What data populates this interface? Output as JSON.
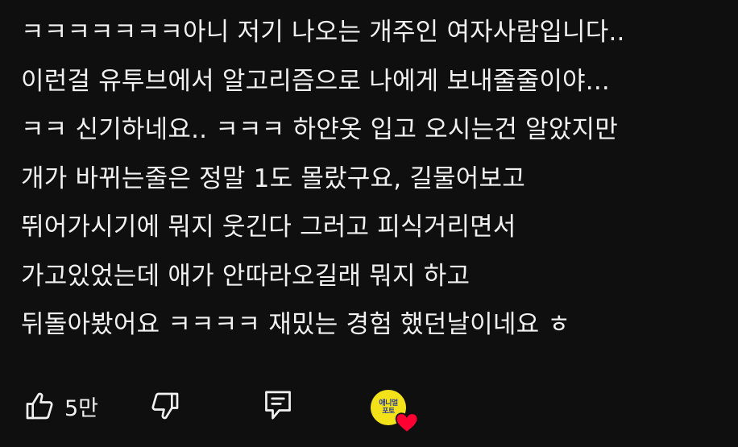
{
  "comment": {
    "lines": [
      "ㅋㅋㅋㅋㅋㅋㅋ아니 저기 나오는 개주인  여자사람입니다..",
      "이런걸 유투브에서 알고리즘으로 나에게 보내줄줄이야...",
      "ㅋㅋ 신기하네요.. ㅋㅋㅋ 하얀옷 입고 오시는건 알았지만",
      "개가 바뀌는줄은 정말 1도 몰랐구요, 길물어보고",
      "뛰어가시기에 뭐지 웃긴다 그러고 피식거리면서",
      "가고있었는데 애가 안따라오길래 뭐지 하고",
      "뒤돌아봤어요 ㅋㅋㅋㅋ 재밌는 경험 했던날이네요 ㅎ"
    ]
  },
  "actions": {
    "like_count": "5만",
    "like_icon": "thumbs-up-icon",
    "dislike_icon": "thumbs-down-icon",
    "reply_icon": "reply-comment-icon",
    "creator_heart": {
      "avatar_text_line1": "애니멀",
      "avatar_text_line2": "포토",
      "heart_color": "#ff0033",
      "avatar_color": "#f3e11a"
    }
  }
}
